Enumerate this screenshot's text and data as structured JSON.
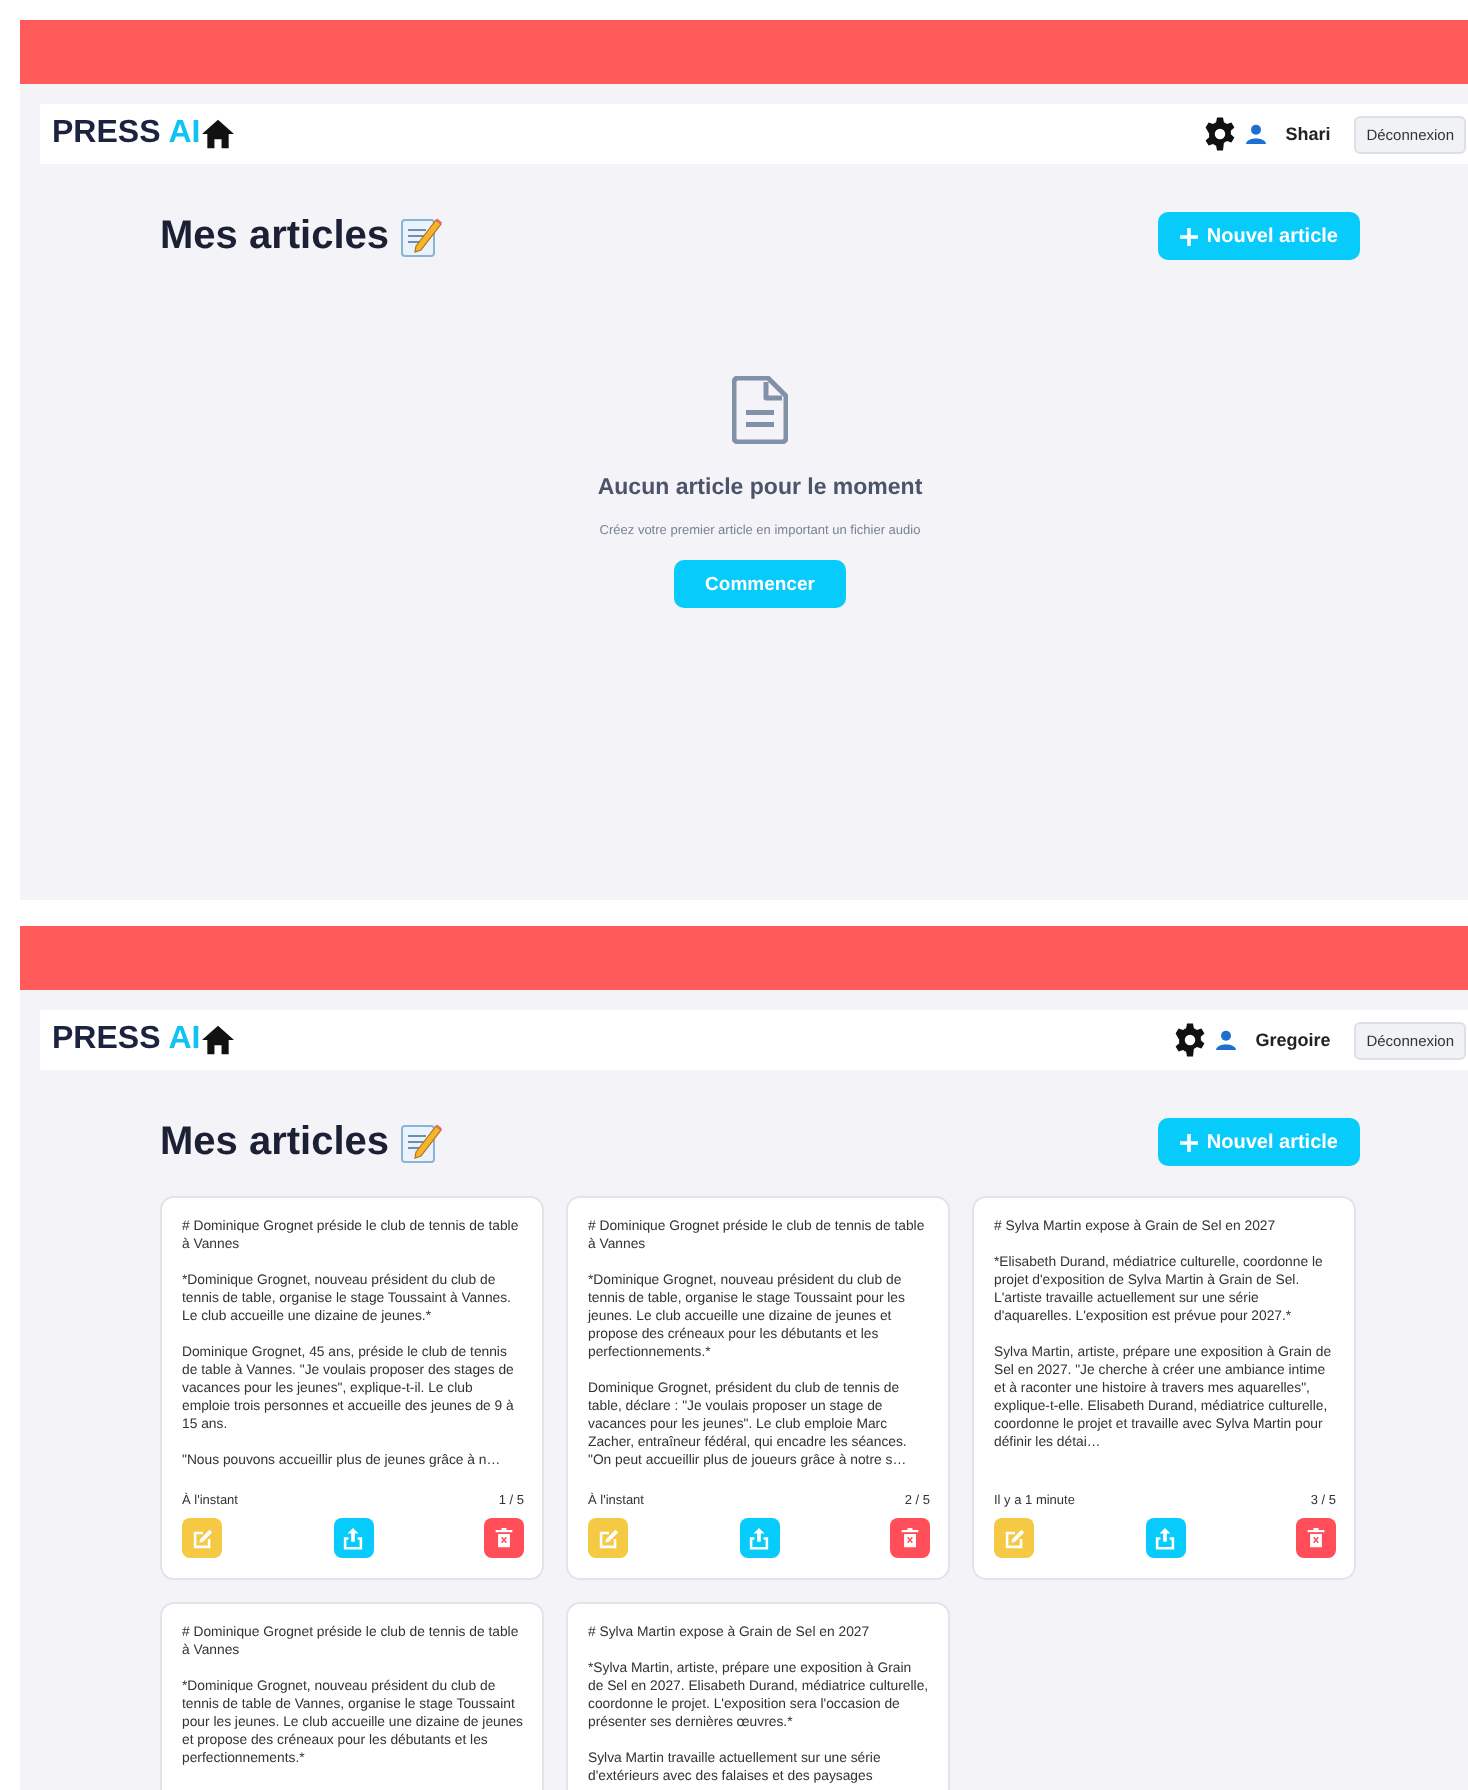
{
  "screens": [
    {
      "logo": {
        "word_1": "PRESS",
        "word_2": "AI"
      },
      "user_name": "Shari",
      "logout": "Déconnexion",
      "heading": "Mes articles",
      "new_article": "Nouvel article",
      "empty_state": {
        "title": "Aucun article pour le moment",
        "subtitle": "Créez votre premier article en important un fichier audio",
        "button": "Commencer"
      }
    },
    {
      "logo": {
        "word_1": "PRESS",
        "word_2": "AI"
      },
      "user_name": "Gregoire",
      "logout": "Déconnexion",
      "heading": "Mes articles",
      "new_article": "Nouvel article",
      "articles": [
        {
          "paragraphs": [
            "# Dominique Grognet préside le club de tennis de table à Vannes",
            "*Dominique Grognet, nouveau président du club de tennis de table, organise le stage Toussaint à Vannes. Le club accueille une dizaine de jeunes.*",
            "Dominique Grognet, 45 ans, préside le club de tennis de table à Vannes. \"Je voulais proposer des stages de vacances pour les jeunes\", explique-t-il. Le club emploie trois personnes et accueille des jeunes de 9 à 15 ans.",
            "\"Nous pouvons accueillir plus de jeunes grâce à n…"
          ],
          "time": "À l'instant",
          "counter": "1 / 5"
        },
        {
          "paragraphs": [
            "# Dominique Grognet préside le club de tennis de table à Vannes",
            "*Dominique Grognet, nouveau président du club de tennis de table, organise le stage Toussaint pour les jeunes. Le club accueille une dizaine de jeunes et propose des créneaux pour les débutants et les perfectionnements.*",
            "Dominique Grognet, président du club de tennis de table, déclare : \"Je voulais proposer un stage de vacances pour les jeunes\". Le club emploie Marc Zacher, entraîneur fédéral, qui encadre les séances. \"On peut accueillir plus de joueurs grâce à notre s…"
          ],
          "time": "À l'instant",
          "counter": "2 / 5"
        },
        {
          "paragraphs": [
            "# Sylva Martin expose à Grain de Sel en 2027",
            "*Elisabeth Durand, médiatrice culturelle, coordonne le projet d'exposition de Sylva Martin à Grain de Sel. L'artiste travaille actuellement sur une série d'aquarelles. L'exposition est prévue pour 2027.*",
            "Sylva Martin, artiste, prépare une exposition à Grain de Sel en 2027. \"Je cherche à créer une ambiance intime et à raconter une histoire à travers mes aquarelles\", explique-t-elle. Elisabeth Durand, médiatrice culturelle, coordonne le projet et travaille avec Sylva Martin pour définir les détai…"
          ],
          "time": "Il y a 1 minute",
          "counter": "3 / 5"
        },
        {
          "paragraphs": [
            "# Dominique Grognet préside le club de tennis de table à Vannes",
            "*Dominique Grognet, nouveau président du club de tennis de table de Vannes, organise le stage Toussaint pour les jeunes. Le club accueille une dizaine de jeunes et propose des créneaux pour les débutants et les perfectionnements.*"
          ]
        },
        {
          "paragraphs": [
            "# Sylva Martin expose à Grain de Sel en 2027",
            "*Sylva Martin, artiste, prépare une exposition à Grain de Sel en 2027. Elisabeth Durand, médiatrice culturelle, coordonne le projet. L'exposition sera l'occasion de présenter ses dernières œuvres.*",
            "Sylva Martin travaille actuellement sur une série d'extérieurs avec des falaises et des paysages"
          ]
        }
      ]
    }
  ]
}
